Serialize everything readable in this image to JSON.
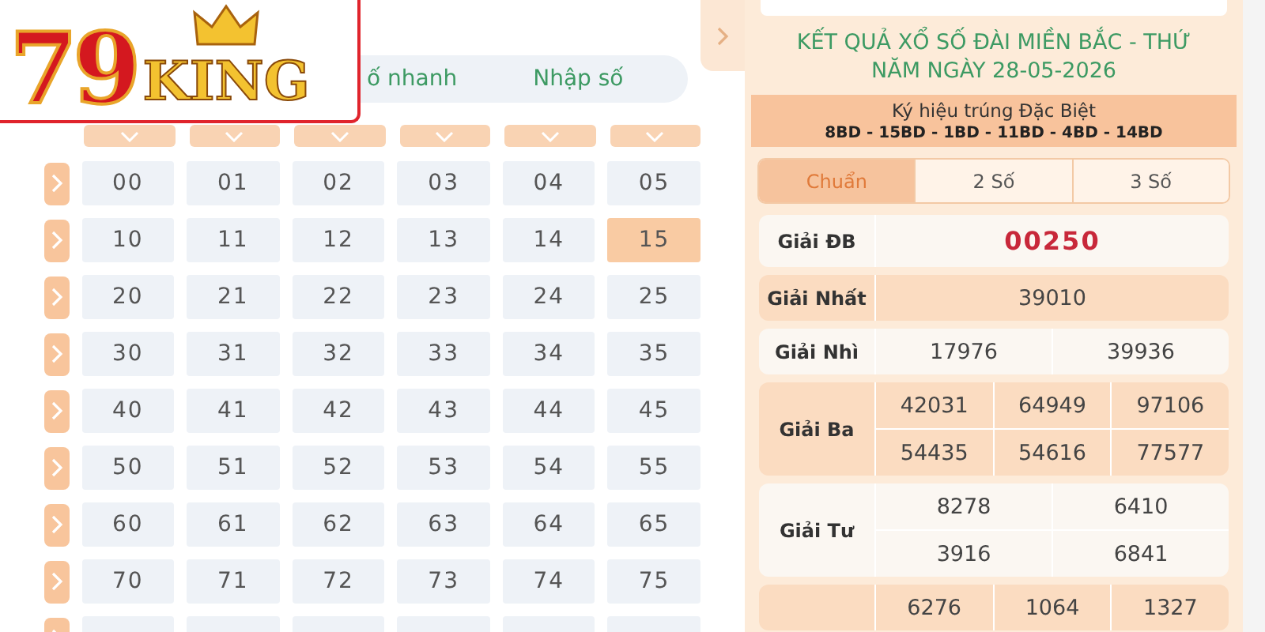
{
  "logo": {
    "number": "79",
    "word": "KING"
  },
  "mode_tabs": [
    {
      "label": "ố nhanh",
      "selected": false
    },
    {
      "label": "Nhập số",
      "selected": false
    }
  ],
  "grid": {
    "rows": [
      {
        "cells": [
          {
            "label": "00",
            "selected": false
          },
          {
            "label": "01",
            "selected": false
          },
          {
            "label": "02",
            "selected": false
          },
          {
            "label": "03",
            "selected": false
          },
          {
            "label": "04",
            "selected": false
          },
          {
            "label": "05",
            "selected": false
          }
        ]
      },
      {
        "cells": [
          {
            "label": "10",
            "selected": false
          },
          {
            "label": "11",
            "selected": false
          },
          {
            "label": "12",
            "selected": false
          },
          {
            "label": "13",
            "selected": false
          },
          {
            "label": "14",
            "selected": false
          },
          {
            "label": "15",
            "selected": true
          }
        ]
      },
      {
        "cells": [
          {
            "label": "20",
            "selected": false
          },
          {
            "label": "21",
            "selected": false
          },
          {
            "label": "22",
            "selected": false
          },
          {
            "label": "23",
            "selected": false
          },
          {
            "label": "24",
            "selected": false
          },
          {
            "label": "25",
            "selected": false
          }
        ]
      },
      {
        "cells": [
          {
            "label": "30",
            "selected": false
          },
          {
            "label": "31",
            "selected": false
          },
          {
            "label": "32",
            "selected": false
          },
          {
            "label": "33",
            "selected": false
          },
          {
            "label": "34",
            "selected": false
          },
          {
            "label": "35",
            "selected": false
          }
        ]
      },
      {
        "cells": [
          {
            "label": "40",
            "selected": false
          },
          {
            "label": "41",
            "selected": false
          },
          {
            "label": "42",
            "selected": false
          },
          {
            "label": "43",
            "selected": false
          },
          {
            "label": "44",
            "selected": false
          },
          {
            "label": "45",
            "selected": false
          }
        ]
      },
      {
        "cells": [
          {
            "label": "50",
            "selected": false
          },
          {
            "label": "51",
            "selected": false
          },
          {
            "label": "52",
            "selected": false
          },
          {
            "label": "53",
            "selected": false
          },
          {
            "label": "54",
            "selected": false
          },
          {
            "label": "55",
            "selected": false
          }
        ]
      },
      {
        "cells": [
          {
            "label": "60",
            "selected": false
          },
          {
            "label": "61",
            "selected": false
          },
          {
            "label": "62",
            "selected": false
          },
          {
            "label": "63",
            "selected": false
          },
          {
            "label": "64",
            "selected": false
          },
          {
            "label": "65",
            "selected": false
          }
        ]
      },
      {
        "cells": [
          {
            "label": "70",
            "selected": false
          },
          {
            "label": "71",
            "selected": false
          },
          {
            "label": "72",
            "selected": false
          },
          {
            "label": "73",
            "selected": false
          },
          {
            "label": "74",
            "selected": false
          },
          {
            "label": "75",
            "selected": false
          }
        ]
      },
      {
        "cells": [
          {
            "selected": false
          },
          {
            "selected": false
          },
          {
            "selected": false
          },
          {
            "selected": false
          },
          {
            "selected": false
          },
          {
            "selected": false
          }
        ]
      }
    ]
  },
  "results": {
    "title": "KẾT QUẢ XỔ SỐ ĐÀI MIỀN BẮC - THỨ NĂM NGÀY 28-05-2026",
    "symbol_label": "Ký hiệu trúng Đặc Biệt",
    "symbols": "8BD - 15BD - 1BD - 11BD - 4BD - 14BD",
    "tabs": [
      {
        "label": "Chuẩn",
        "selected": true
      },
      {
        "label": "2 Số",
        "selected": false
      },
      {
        "label": "3 Số",
        "selected": false
      }
    ],
    "prizes": [
      {
        "label": "Giải ĐB",
        "kind": "special",
        "lines": [
          [
            "00250"
          ]
        ]
      },
      {
        "label": "Giải Nhất",
        "kind": "normal",
        "lines": [
          [
            "39010"
          ]
        ]
      },
      {
        "label": "Giải Nhì",
        "kind": "normal",
        "lines": [
          [
            "17976",
            "39936"
          ]
        ]
      },
      {
        "label": "Giải Ba",
        "kind": "normal",
        "lines": [
          [
            "42031",
            "64949",
            "97106"
          ],
          [
            "54435",
            "54616",
            "77577"
          ]
        ]
      },
      {
        "label": "Giải Tư",
        "kind": "normal",
        "lines": [
          [
            "8278",
            "6410"
          ],
          [
            "3916",
            "6841"
          ]
        ]
      },
      {
        "kind": "normal",
        "lines": [
          [
            "6276",
            "1064",
            "1327"
          ]
        ]
      }
    ]
  }
}
